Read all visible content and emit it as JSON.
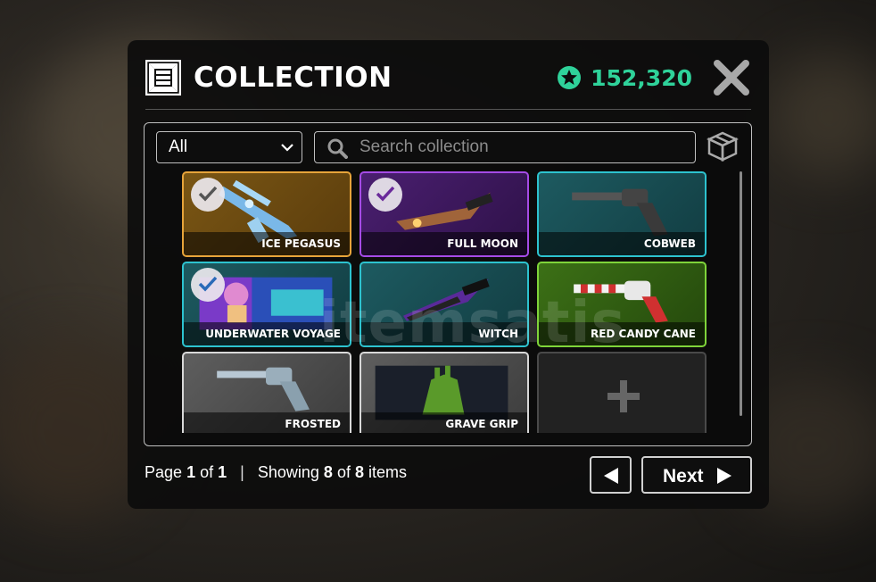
{
  "header": {
    "title": "COLLECTION",
    "currency_value": "152,320",
    "currency_color": "#2fd29a",
    "logo_icon": "collection-logo-icon",
    "close_icon": "close-icon"
  },
  "toolbar": {
    "filter_value": "All",
    "search_placeholder": "Search collection",
    "box_icon": "box-icon"
  },
  "items": [
    {
      "name": "ICE PEGASUS",
      "checked": true,
      "border": "#e7a43a",
      "bg": "#6a4a10"
    },
    {
      "name": "FULL MOON",
      "checked": true,
      "border": "#a54be6",
      "bg": "#3a1a58"
    },
    {
      "name": "COBWEB",
      "checked": false,
      "border": "#2dc3cf",
      "bg": "#174b50"
    },
    {
      "name": "UNDERWATER VOYAGE",
      "checked": true,
      "border": "#2dc3cf",
      "bg": "#174b50"
    },
    {
      "name": "WITCH",
      "checked": false,
      "border": "#2dc3cf",
      "bg": "#174b50"
    },
    {
      "name": "RED CANDY CANE",
      "checked": false,
      "border": "#7fd43a",
      "bg": "#2e5810"
    },
    {
      "name": "FROSTED",
      "checked": false,
      "border": "#d8d8d8",
      "bg": "#4f4f4f"
    },
    {
      "name": "GRAVE GRIP",
      "checked": false,
      "border": "#d8d8d8",
      "bg": "#4f4f4f"
    }
  ],
  "add_slot_icon": "plus-icon",
  "footer": {
    "page_word": "Page",
    "page_current": "1",
    "of_word": "of",
    "page_total": "1",
    "separator": "|",
    "showing_word": "Showing",
    "shown_count": "8",
    "of_word2": "of",
    "total_count": "8",
    "items_word": "items",
    "next_label": "Next"
  },
  "watermark": "itemsatis"
}
